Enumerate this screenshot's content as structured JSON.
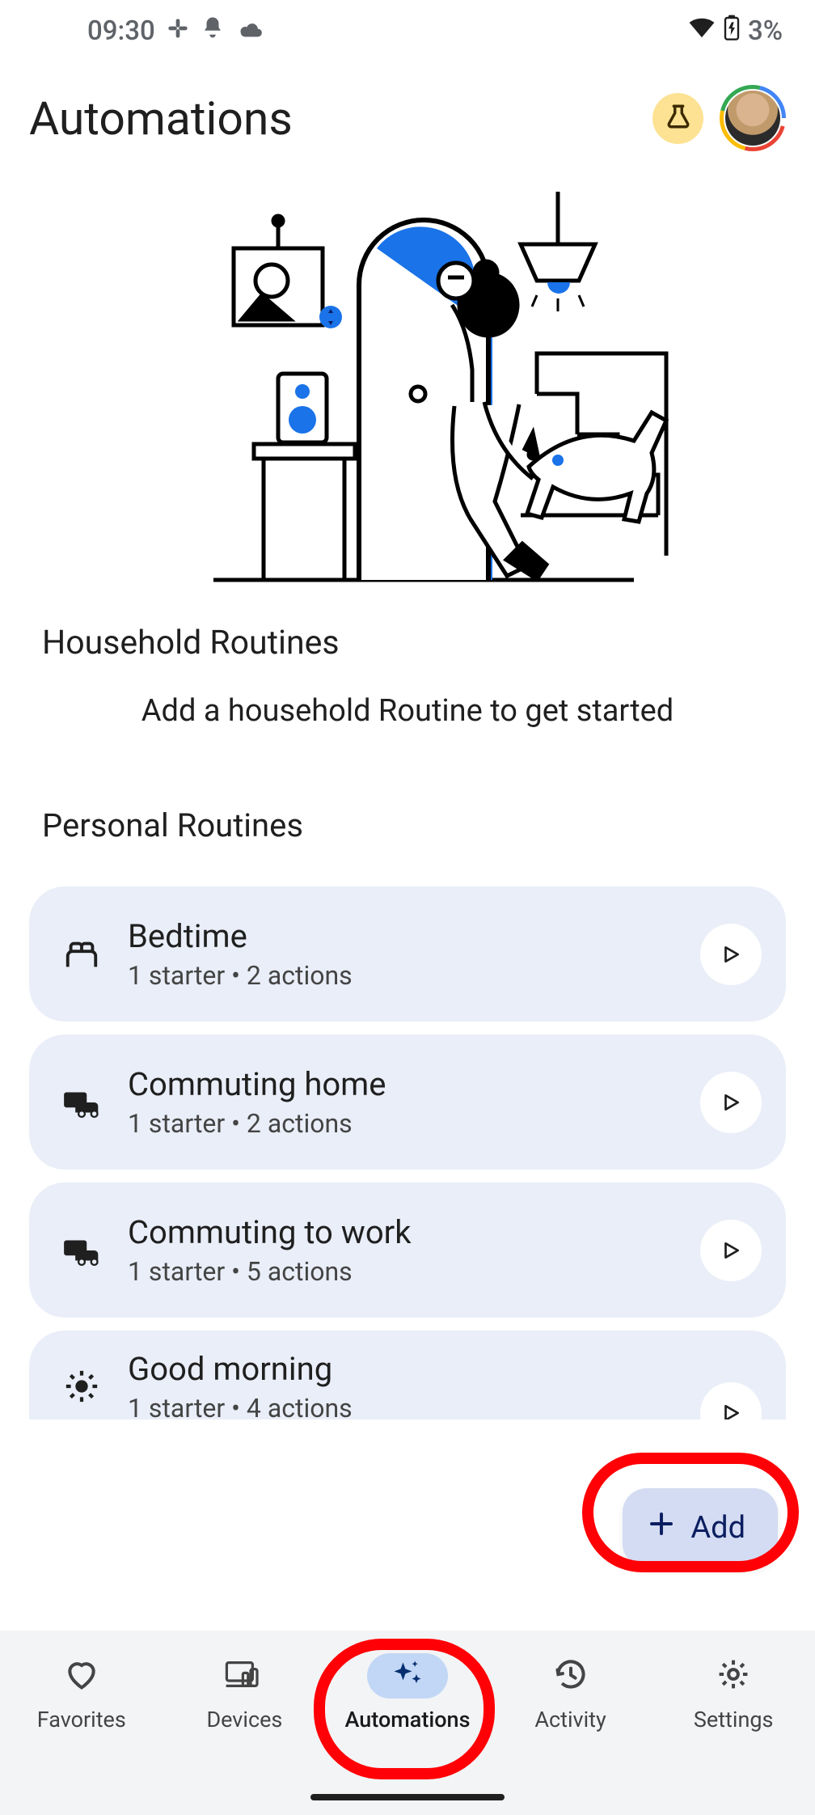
{
  "status": {
    "time": "09:30",
    "battery_text": "3%"
  },
  "header": {
    "title": "Automations"
  },
  "household": {
    "title": "Household Routines",
    "empty": "Add a household Routine to get started"
  },
  "personal": {
    "title": "Personal Routines",
    "routines": [
      {
        "title": "Bedtime",
        "subtitle": "1 starter • 2 actions",
        "icon": "bed"
      },
      {
        "title": "Commuting home",
        "subtitle": "1 starter • 2 actions",
        "icon": "commute"
      },
      {
        "title": "Commuting to work",
        "subtitle": "1 starter • 5 actions",
        "icon": "commute"
      },
      {
        "title": "Good morning",
        "subtitle": "1 starter • 4 actions",
        "icon": "sun"
      }
    ]
  },
  "fab": {
    "label": "Add"
  },
  "nav": {
    "items": [
      {
        "label": "Favorites",
        "icon": "heart"
      },
      {
        "label": "Devices",
        "icon": "devices"
      },
      {
        "label": "Automations",
        "icon": "sparkle",
        "active": true
      },
      {
        "label": "Activity",
        "icon": "history"
      },
      {
        "label": "Settings",
        "icon": "gear"
      }
    ]
  }
}
